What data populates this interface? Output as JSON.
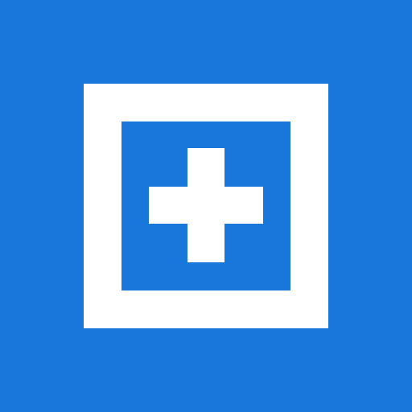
{
  "icon": {
    "name": "add-in-frame-icon",
    "background_color": "#1976DB",
    "foreground_color": "#FFFFFF"
  }
}
